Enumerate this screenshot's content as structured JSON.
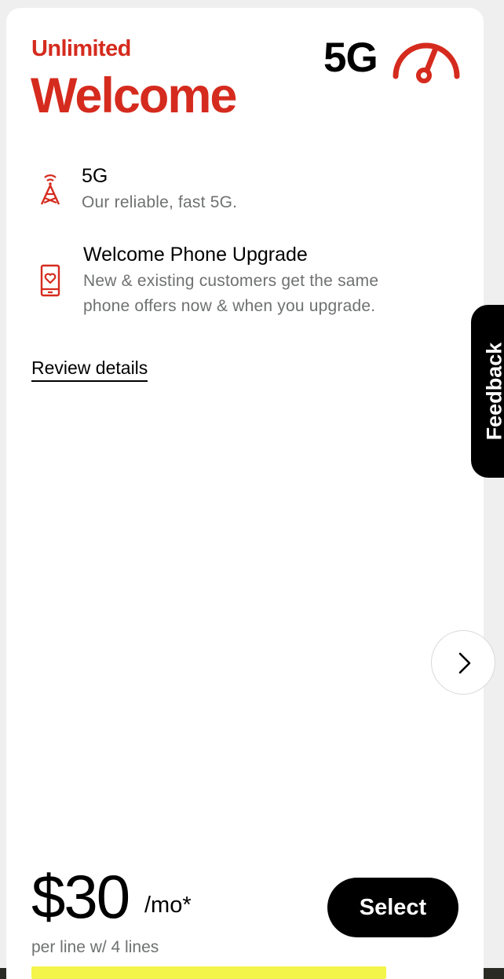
{
  "plan": {
    "kicker": "Unlimited",
    "title": "Welcome",
    "badge_text": "5G",
    "badge_icon": "speedometer-icon"
  },
  "features": [
    {
      "icon": "cell-tower-icon",
      "title": "5G",
      "description_lines": [
        "Our reliable, fast 5G."
      ]
    },
    {
      "icon": "phone-heart-icon",
      "title": "Welcome Phone Upgrade",
      "description_lines": [
        "New & existing customers get the same",
        "phone offers now & when you upgrade."
      ]
    }
  ],
  "review_link": "Review details",
  "pricing": {
    "amount": "$30",
    "unit": "/mo*",
    "note": "per line w/ 4 lines"
  },
  "select_label": "Select",
  "feedback_label": "Feedback",
  "carousel": {
    "next_icon": "chevron-right-icon"
  },
  "colors": {
    "brand_red": "#d52b1e",
    "text_black": "#000000",
    "text_gray": "#6f7171",
    "promo_yellow": "#f4f54a"
  }
}
